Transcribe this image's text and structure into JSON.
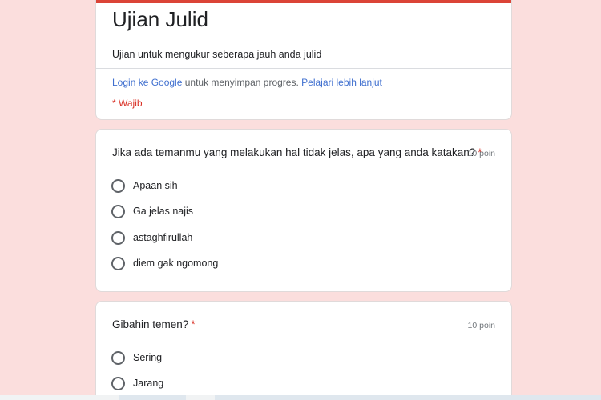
{
  "form": {
    "title": "Ujian Julid",
    "description": "Ujian untuk mengukur seberapa jauh anda julid",
    "login_link": "Login ke Google",
    "login_text": " untuk menyimpan progres. ",
    "learn_more_link": "Pelajari lebih lanjut",
    "required_note": "* Wajib",
    "accent_color": "#db4437",
    "background_color": "#fbdedd"
  },
  "questions": [
    {
      "title": "Jika ada temanmu yang melakukan hal tidak jelas, apa yang anda katakan?",
      "required_mark": "*",
      "points": "10 poin",
      "options": [
        "Apaan sih",
        "Ga jelas najis",
        "astaghfirullah",
        "diem gak ngomong"
      ]
    },
    {
      "title": "Gibahin temen?",
      "required_mark": "*",
      "points": "10 poin",
      "options": [
        "Sering",
        "Jarang"
      ]
    }
  ]
}
